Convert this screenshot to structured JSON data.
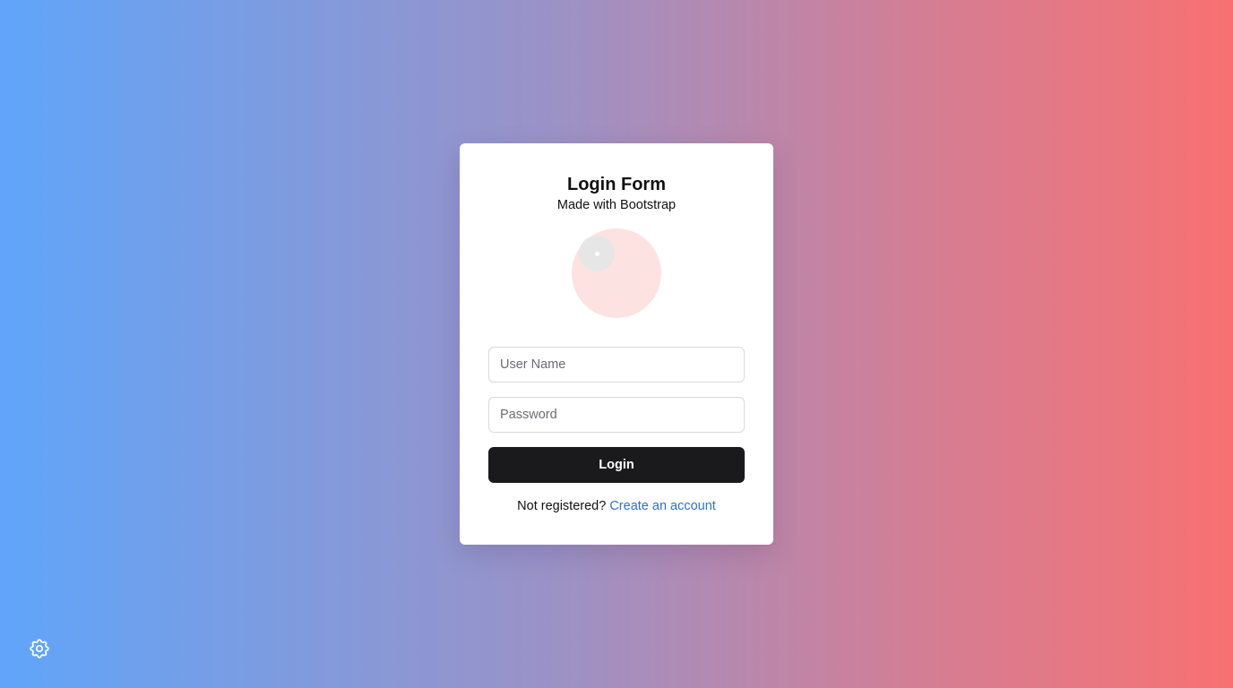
{
  "form": {
    "title": "Login Form",
    "subtitle": "Made with Bootstrap",
    "username_placeholder": "User Name",
    "password_placeholder": "Password",
    "login_label": "Login",
    "register_prompt": "Not registered?",
    "register_link": "Create an account"
  },
  "icons": {
    "avatar": "avatar-placeholder",
    "settings": "gear-icon"
  },
  "colors": {
    "gradient_start": "#60a5fa",
    "gradient_end": "#f87171",
    "button": "#1a1a1c",
    "link": "#2f6fd6",
    "avatar_bg": "#fde2e2"
  }
}
